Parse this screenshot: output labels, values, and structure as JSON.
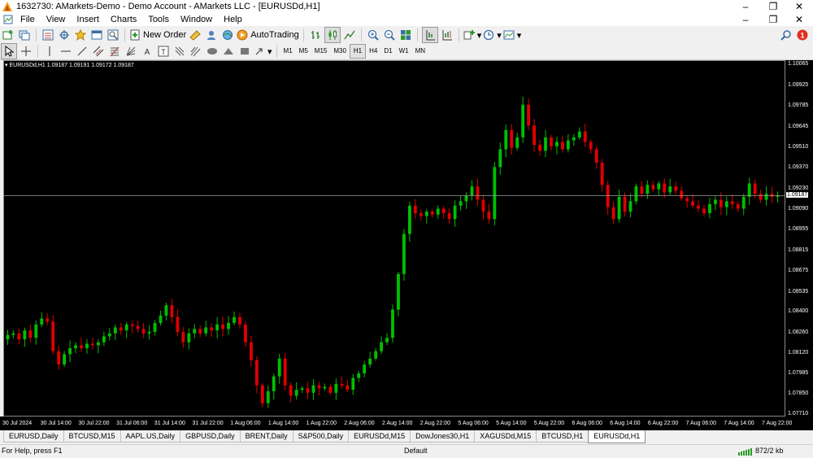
{
  "window": {
    "title": "1632730: AMarkets-Demo - Demo Account - AMarkets LLC - [EURUSDd,H1]"
  },
  "menu": {
    "items": [
      "File",
      "View",
      "Insert",
      "Charts",
      "Tools",
      "Window",
      "Help"
    ]
  },
  "toolbar": {
    "new_order_label": "New Order",
    "autotrading_label": "AutoTrading",
    "timeframes": [
      "M1",
      "M5",
      "M15",
      "M30",
      "H1",
      "H4",
      "D1",
      "W1",
      "MN"
    ],
    "active_timeframe": "H1",
    "notification_count": "1"
  },
  "chart": {
    "symbol_info": "EURUSDd,H1  1.09187 1.09191 1.09172 1.09187",
    "current_price": "1.09187",
    "bull_color": "#00c000",
    "bear_color": "#e00000"
  },
  "chart_data": {
    "type": "candlestick",
    "symbol": "EURUSDd",
    "timeframe": "H1",
    "ylim": [
      1.077,
      1.101
    ],
    "price_ticks": [
      "1.10065",
      "1.09925",
      "1.09785",
      "1.09645",
      "1.09510",
      "1.09370",
      "1.09230",
      "1.09090",
      "1.08955",
      "1.08815",
      "1.08675",
      "1.08535",
      "1.08400",
      "1.08260",
      "1.08120",
      "1.07985",
      "1.07850",
      "1.07710"
    ],
    "time_ticks": [
      "30 Jul 2024",
      "30 Jul 14:00",
      "30 Jul 22:00",
      "31 Jul 06:00",
      "31 Jul 14:00",
      "31 Jul 22:00",
      "1 Aug 06:00",
      "1 Aug 14:00",
      "1 Aug 22:00",
      "2 Aug 06:00",
      "2 Aug 14:00",
      "2 Aug 22:00",
      "5 Aug 06:00",
      "5 Aug 14:00",
      "5 Aug 22:00",
      "6 Aug 06:00",
      "6 Aug 14:00",
      "6 Aug 22:00",
      "7 Aug 06:00",
      "7 Aug 14:00",
      "7 Aug 22:00"
    ],
    "current_price": 1.09187,
    "closes": [
      1.0825,
      1.0826,
      1.0822,
      1.0828,
      1.0823,
      1.0832,
      1.0836,
      1.0834,
      1.0814,
      1.0805,
      1.0812,
      1.0816,
      1.0818,
      1.0816,
      1.0819,
      1.0818,
      1.082,
      1.0824,
      1.0826,
      1.083,
      1.0828,
      1.0832,
      1.0831,
      1.0829,
      1.0826,
      1.0827,
      1.0833,
      1.0838,
      1.0845,
      1.0837,
      1.0827,
      1.082,
      1.0826,
      1.0829,
      1.0826,
      1.083,
      1.0828,
      1.0832,
      1.0829,
      1.0833,
      1.0837,
      1.0832,
      1.082,
      1.0808,
      1.0791,
      1.0779,
      1.0787,
      1.0797,
      1.0809,
      1.0791,
      1.0784,
      1.0788,
      1.0789,
      1.0786,
      1.0791,
      1.0789,
      1.079,
      1.0786,
      1.0792,
      1.0791,
      1.0788,
      1.0796,
      1.0799,
      1.0805,
      1.0809,
      1.0814,
      1.082,
      1.0823,
      1.0842,
      1.0866,
      1.0893,
      1.0912,
      1.0907,
      1.0905,
      1.0908,
      1.0906,
      1.091,
      1.0907,
      1.0903,
      1.0912,
      1.0915,
      1.0919,
      1.0925,
      1.0916,
      1.0908,
      1.0903,
      1.0938,
      1.095,
      1.0963,
      1.0951,
      1.0958,
      1.098,
      1.0966,
      1.0953,
      1.0949,
      1.0958,
      1.0952,
      1.0955,
      1.095,
      1.0956,
      1.0958,
      1.0962,
      1.0955,
      1.095,
      1.0941,
      1.0926,
      1.0911,
      1.0903,
      1.0918,
      1.0908,
      1.0915,
      1.0925,
      1.092,
      1.0926,
      1.0923,
      1.0927,
      1.0921,
      1.0925,
      1.0922,
      1.0917,
      1.0915,
      1.0912,
      1.091,
      1.0907,
      1.0913,
      1.0916,
      1.0911,
      1.0915,
      1.0913,
      1.091,
      1.0918,
      1.0927,
      1.092,
      1.0916,
      1.092,
      1.0918,
      1.0919
    ]
  },
  "tabs": [
    {
      "label": "EURUSD,Daily"
    },
    {
      "label": "BTCUSD,M15"
    },
    {
      "label": "AAPL.US,Daily"
    },
    {
      "label": "GBPUSD,Daily"
    },
    {
      "label": "BRENT,Daily"
    },
    {
      "label": "S&P500,Daily"
    },
    {
      "label": "EURUSDd,M15"
    },
    {
      "label": "DowJones30,H1"
    },
    {
      "label": "XAGUSDd,M15"
    },
    {
      "label": "BTCUSD,H1"
    },
    {
      "label": "EURUSDd,H1"
    }
  ],
  "active_tab": "EURUSDd,H1",
  "status": {
    "help_text": "For Help, press F1",
    "profile": "Default",
    "traffic": "872/2 kb"
  }
}
